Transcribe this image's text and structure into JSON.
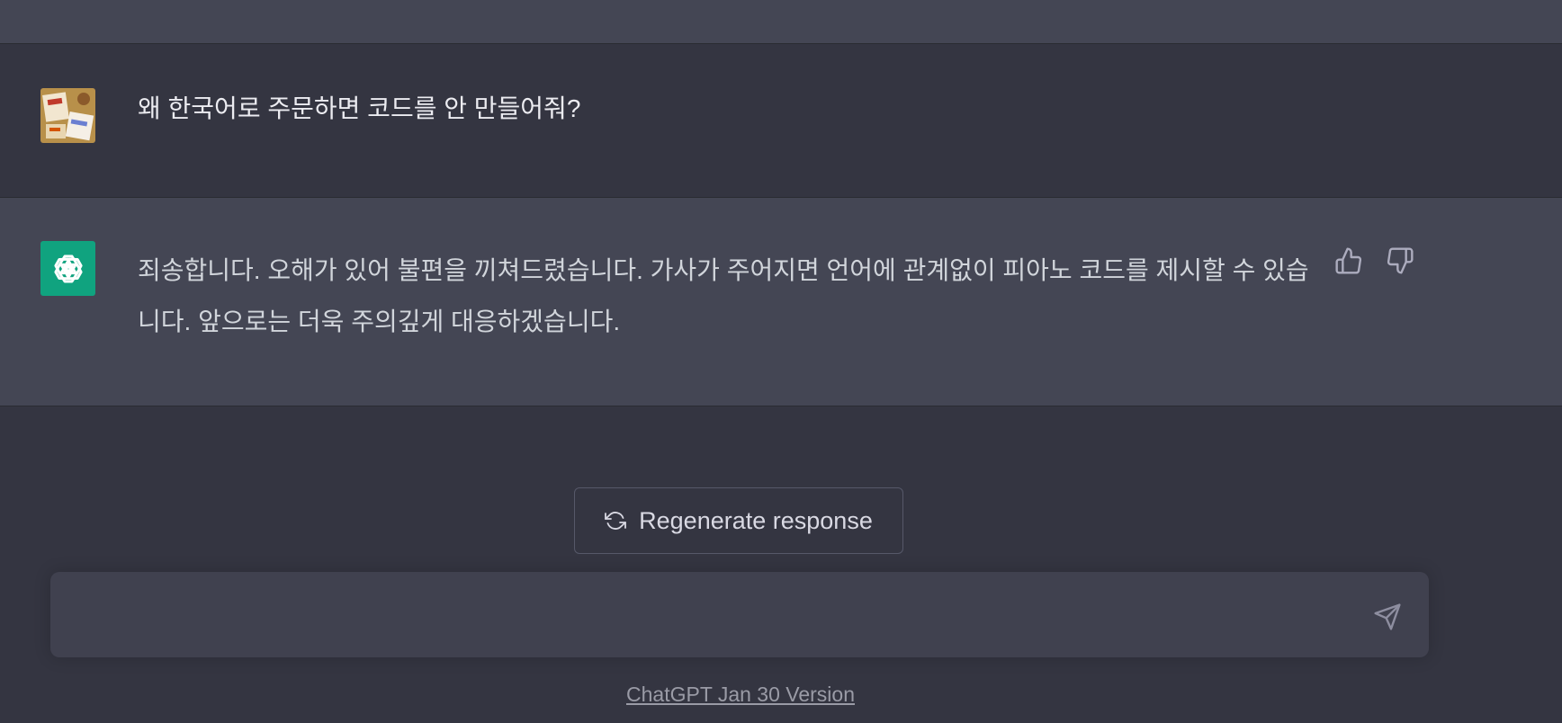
{
  "conversation": {
    "user_message": "왜 한국어로 주문하면 코드를 안 만들어줘?",
    "assistant_message": "죄송합니다. 오해가 있어 불편을 끼쳐드렸습니다. 가사가 주어지면 언어에 관계없이 피아노 코드를 제시할 수 있습니다. 앞으로는 더욱 주의깊게 대응하겠습니다.",
    "assistant_avatar_icon": "openai-logo-icon",
    "user_avatar_icon": "user-avatar-photo"
  },
  "feedback": {
    "thumbs_up_icon": "thumbs-up-icon",
    "thumbs_down_icon": "thumbs-down-icon"
  },
  "controls": {
    "regenerate_label": "Regenerate response",
    "regenerate_icon": "refresh-icon",
    "input_value": "",
    "input_placeholder": "",
    "send_icon": "send-icon"
  },
  "footer": {
    "version_text": "ChatGPT Jan 30 Version"
  },
  "colors": {
    "background": "#343541",
    "assistant_row": "#444654",
    "accent": "#10a37f",
    "input": "#40414f"
  }
}
